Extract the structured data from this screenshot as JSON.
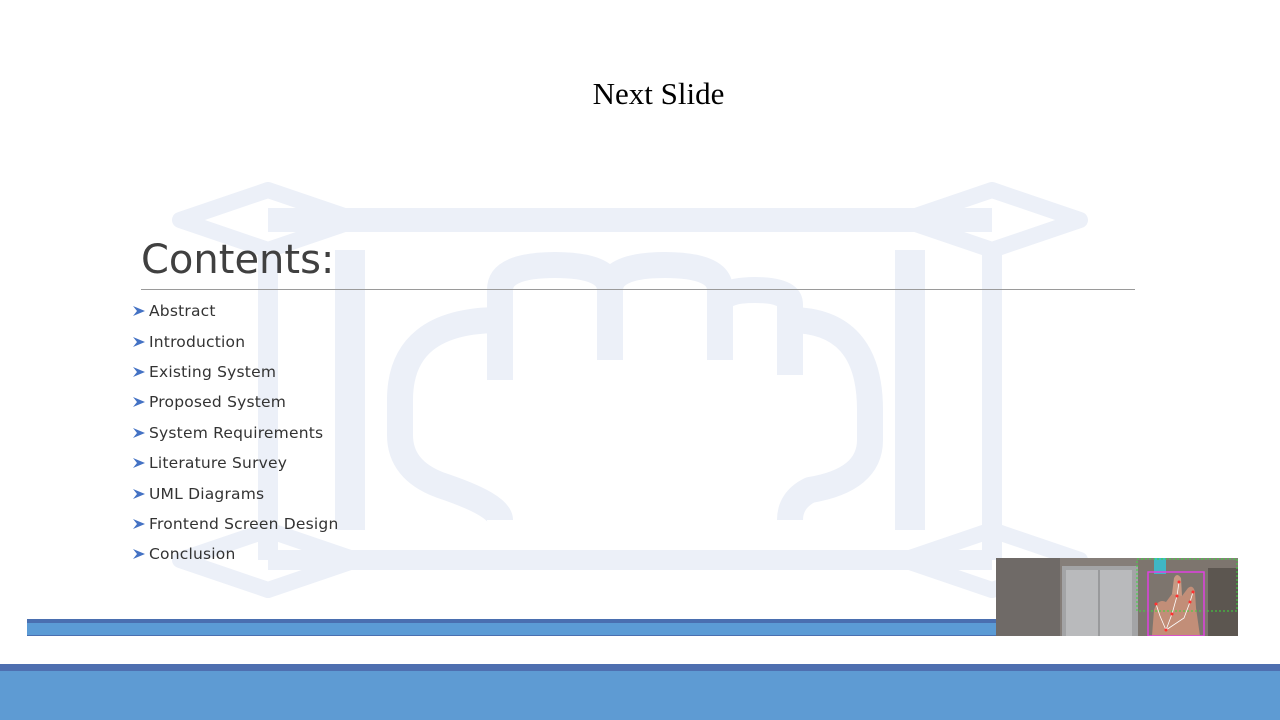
{
  "status": {
    "text": "Next Slide"
  },
  "slide": {
    "title": "Contents:",
    "items": [
      "Abstract",
      "Introduction",
      "Existing System",
      "Proposed System",
      "System Requirements",
      "Literature Survey",
      "UML Diagrams",
      "Frontend Screen Design",
      "Conclusion"
    ],
    "bullet_icon": "arrow-bullet-icon",
    "colors": {
      "title": "#404040",
      "text": "#333333",
      "watermark": "#ecf0f8",
      "band_dark": "#4a6fb0",
      "band_light": "#5b9bd5",
      "bullet_arrow": "#4472c4"
    }
  },
  "webcam": {
    "overlay_icon": "hand-tracking-overlay"
  }
}
